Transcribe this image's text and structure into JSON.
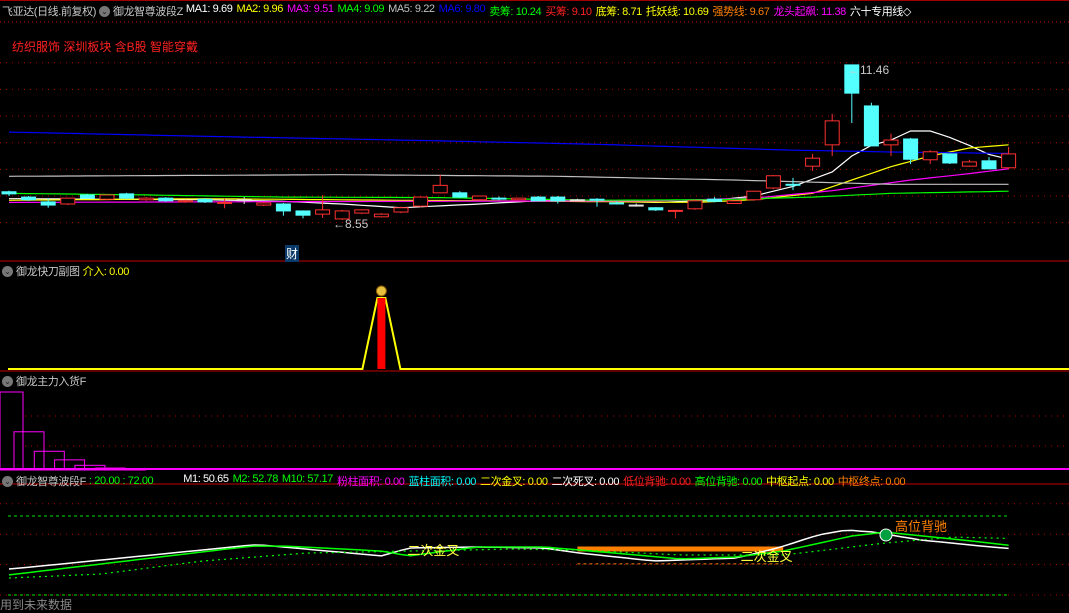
{
  "header": {
    "stock": "飞亚达(日线.前复权)",
    "indicator": "御龙智尊波段Z",
    "items": [
      {
        "label": "MA1: 9.69",
        "color": "#ffffff"
      },
      {
        "label": "MA2: 9.96",
        "color": "#ffff00"
      },
      {
        "label": "MA3: 9.51",
        "color": "#ff00ff"
      },
      {
        "label": "MA4: 9.09",
        "color": "#00ff00"
      },
      {
        "label": "MA5: 9.22",
        "color": "#c0c0c0"
      },
      {
        "label": "MA6: 9.80",
        "color": "#0000ff"
      },
      {
        "label": "卖筹: 10.24",
        "color": "#00ff00"
      },
      {
        "label": "买筹: 9.10",
        "color": "#ff2020"
      },
      {
        "label": "底筹: 8.71",
        "color": "#ffff00"
      },
      {
        "label": "托妖线: 10.69",
        "color": "#ffff00"
      },
      {
        "label": "强势线: 9.67",
        "color": "#ff8000"
      },
      {
        "label": "龙头起飙: 11.38",
        "color": "#ff00ff"
      },
      {
        "label": "六十专用线◇",
        "color": "#ffffff"
      }
    ]
  },
  "sectors": "纺织服饰 深圳板块 含B股 智能穿戴",
  "main_annotations": {
    "high": "←11.46",
    "low": "←8.55",
    "badge": "财"
  },
  "panel2": {
    "title": "御龙快刀副图",
    "value": "介入: 0.00"
  },
  "panel3": {
    "title": "御龙主力入货F"
  },
  "panel4": {
    "title": "御龙智尊波段F",
    "levels": ": 20.00  : 72.00",
    "items": [
      {
        "label": "M1: 50.65",
        "color": "#ffffff"
      },
      {
        "label": "M2: 52.78",
        "color": "#00ff00"
      },
      {
        "label": "M10: 57.17",
        "color": "#00ff00"
      },
      {
        "label": "粉柱面积: 0.00",
        "color": "#ff00ff"
      },
      {
        "label": "蓝柱面积: 0.00",
        "color": "#00ffff"
      },
      {
        "label": "二次金叉: 0.00",
        "color": "#ffff00"
      },
      {
        "label": "二次死叉: 0.00",
        "color": "#ffffff"
      },
      {
        "label": "低位背驰: 0.00",
        "color": "#ff2020"
      },
      {
        "label": "高位背驰: 0.00",
        "color": "#00ff00"
      },
      {
        "label": "中枢起点: 0.00",
        "color": "#ffff00"
      },
      {
        "label": "中枢终点: 0.00",
        "color": "#ff8000"
      }
    ],
    "signal_golden": "二次金叉",
    "signal_high": "高位背驰"
  },
  "footer": "用到未来数据",
  "chart_data": [
    {
      "type": "candlestick",
      "title": "飞亚达(日线.前复权)",
      "ylim": [
        8.5,
        11.5
      ],
      "candles": [
        [
          9.08,
          9.1,
          9.0,
          9.04
        ],
        [
          8.98,
          9.0,
          8.91,
          8.93
        ],
        [
          8.89,
          8.96,
          8.78,
          8.83
        ],
        [
          8.85,
          8.97,
          8.83,
          8.96
        ],
        [
          9.02,
          9.04,
          8.95,
          8.96
        ],
        [
          8.94,
          9.03,
          8.92,
          9.02
        ],
        [
          9.04,
          9.06,
          8.94,
          8.96
        ],
        [
          8.93,
          8.98,
          8.91,
          8.96
        ],
        [
          8.96,
          8.98,
          8.89,
          8.91
        ],
        [
          8.89,
          8.93,
          8.87,
          8.91
        ],
        [
          8.94,
          8.96,
          8.87,
          8.89
        ],
        [
          8.87,
          8.95,
          8.77,
          8.88
        ],
        [
          8.93,
          8.98,
          8.85,
          8.93
        ],
        [
          8.83,
          8.88,
          8.81,
          8.87
        ],
        [
          8.85,
          8.87,
          8.63,
          8.72
        ],
        [
          8.72,
          8.73,
          8.58,
          8.64
        ],
        [
          8.66,
          9.02,
          8.59,
          8.74
        ],
        [
          8.57,
          8.74,
          8.55,
          8.72
        ],
        [
          8.68,
          8.75,
          8.66,
          8.74
        ],
        [
          8.61,
          8.68,
          8.6,
          8.66
        ],
        [
          8.7,
          8.8,
          8.68,
          8.78
        ],
        [
          8.81,
          8.99,
          8.79,
          8.98
        ],
        [
          9.06,
          9.4,
          9.05,
          9.2
        ],
        [
          9.06,
          9.09,
          8.96,
          8.98
        ],
        [
          8.93,
          9.01,
          8.92,
          9.0
        ],
        [
          8.96,
          8.99,
          8.92,
          8.95
        ],
        [
          8.93,
          8.97,
          8.92,
          8.96
        ],
        [
          8.98,
          9.0,
          8.9,
          8.91
        ],
        [
          8.98,
          9.0,
          8.86,
          8.91
        ],
        [
          8.93,
          8.95,
          8.91,
          8.93
        ],
        [
          8.94,
          8.96,
          8.8,
          8.93
        ],
        [
          8.87,
          8.9,
          8.84,
          8.86
        ],
        [
          8.83,
          8.86,
          8.8,
          8.83
        ],
        [
          8.78,
          8.79,
          8.72,
          8.74
        ],
        [
          8.72,
          8.74,
          8.58,
          8.73
        ],
        [
          8.76,
          8.93,
          8.74,
          8.91
        ],
        [
          8.94,
          8.98,
          8.88,
          8.9
        ],
        [
          8.86,
          8.92,
          8.85,
          8.91
        ],
        [
          8.93,
          9.1,
          8.91,
          9.09
        ],
        [
          9.15,
          9.39,
          9.13,
          9.38
        ],
        [
          9.22,
          9.34,
          9.11,
          9.21
        ],
        [
          9.56,
          9.79,
          9.47,
          9.71
        ],
        [
          9.96,
          10.54,
          9.75,
          10.41
        ],
        [
          11.46,
          11.46,
          10.37,
          10.93
        ],
        [
          10.69,
          10.75,
          9.94,
          9.94
        ],
        [
          9.96,
          10.17,
          9.75,
          10.05
        ],
        [
          10.07,
          10.09,
          9.6,
          9.69
        ],
        [
          9.68,
          9.86,
          9.6,
          9.83
        ],
        [
          9.79,
          9.8,
          9.6,
          9.62
        ],
        [
          9.56,
          9.68,
          9.55,
          9.64
        ],
        [
          9.66,
          9.73,
          9.51,
          9.51
        ],
        [
          9.53,
          9.92,
          9.51,
          9.79
        ]
      ],
      "series": [
        {
          "name": "MA1",
          "color": "#ffffff",
          "points": [
            [
              0,
              8.95
            ],
            [
              10,
              8.93
            ],
            [
              14,
              8.9
            ],
            [
              17,
              8.85
            ],
            [
              20,
              8.78
            ],
            [
              24,
              8.85
            ],
            [
              28,
              8.93
            ],
            [
              33,
              8.88
            ],
            [
              36,
              8.92
            ],
            [
              38,
              9.0
            ],
            [
              40,
              9.18
            ],
            [
              42,
              9.45
            ],
            [
              43,
              9.75
            ],
            [
              44,
              9.95
            ],
            [
              45,
              10.05
            ],
            [
              46,
              10.22
            ],
            [
              47,
              10.22
            ],
            [
              48,
              10.1
            ],
            [
              49,
              9.95
            ],
            [
              50,
              9.78
            ],
            [
              51,
              9.69
            ]
          ]
        },
        {
          "name": "MA2",
          "color": "#ffff00",
          "points": [
            [
              0,
              8.92
            ],
            [
              10,
              8.95
            ],
            [
              20,
              8.92
            ],
            [
              28,
              8.9
            ],
            [
              35,
              8.88
            ],
            [
              38,
              8.93
            ],
            [
              41,
              9.05
            ],
            [
              43,
              9.3
            ],
            [
              45,
              9.55
            ],
            [
              47,
              9.75
            ],
            [
              49,
              9.9
            ],
            [
              51,
              9.96
            ]
          ]
        },
        {
          "name": "MA3",
          "color": "#ff00ff",
          "points": [
            [
              0,
              8.88
            ],
            [
              20,
              8.9
            ],
            [
              33,
              8.91
            ],
            [
              38,
              8.96
            ],
            [
              42,
              9.1
            ],
            [
              46,
              9.3
            ],
            [
              49,
              9.42
            ],
            [
              51,
              9.51
            ]
          ]
        },
        {
          "name": "MA4",
          "color": "#00ff00",
          "points": [
            [
              0,
              9.05
            ],
            [
              7,
              9.02
            ],
            [
              14,
              8.98
            ],
            [
              22,
              8.97
            ],
            [
              30,
              8.92
            ],
            [
              36,
              8.93
            ],
            [
              41,
              8.98
            ],
            [
              45,
              9.05
            ],
            [
              51,
              9.09
            ]
          ]
        },
        {
          "name": "MA5",
          "color": "#c0c0c0",
          "points": [
            [
              0,
              9.37
            ],
            [
              17,
              9.4
            ],
            [
              28,
              9.37
            ],
            [
              37,
              9.3
            ],
            [
              45,
              9.22
            ],
            [
              51,
              9.22
            ]
          ]
        },
        {
          "name": "MA6",
          "color": "#0000ff",
          "points": [
            [
              0,
              10.2
            ],
            [
              10,
              10.12
            ],
            [
              20,
              10.05
            ],
            [
              30,
              9.97
            ],
            [
              40,
              9.86
            ],
            [
              46,
              9.82
            ],
            [
              51,
              9.8
            ]
          ]
        }
      ]
    },
    {
      "type": "line",
      "title": "御龙快刀副图",
      "ylim": [
        0,
        1
      ],
      "spike_index": 19,
      "values_note": "介入 zero except one spike"
    },
    {
      "type": "bar",
      "title": "御龙主力入货F",
      "ylim": [
        0,
        100
      ],
      "values": [
        100,
        49,
        24,
        13,
        6,
        2.5,
        1
      ]
    },
    {
      "type": "line",
      "title": "御龙智尊波段F",
      "ylim": [
        20,
        80
      ],
      "levels": [
        20,
        72
      ],
      "series": [
        {
          "name": "M1",
          "color": "#ffffff",
          "points": [
            [
              0,
              37.1
            ],
            [
              1.6,
              39
            ],
            [
              12.4,
              52.9
            ],
            [
              12.9,
              52.9
            ],
            [
              19,
              45.7
            ],
            [
              20.4,
              50.9
            ],
            [
              23.9,
              51.6
            ],
            [
              27.3,
              50.9
            ],
            [
              29.1,
              47.6
            ],
            [
              32.9,
              42.4
            ],
            [
              34.3,
              43
            ],
            [
              37.1,
              44.3
            ],
            [
              39.2,
              50.9
            ],
            [
              41.3,
              59.5
            ],
            [
              42.7,
              62.8
            ],
            [
              44.1,
              61.4
            ],
            [
              46.5,
              56.2
            ],
            [
              49.6,
              52.2
            ],
            [
              51,
              50.65
            ]
          ]
        },
        {
          "name": "M2",
          "color": "#00ff00",
          "points": [
            [
              0,
              33.2
            ],
            [
              12.4,
              52.2
            ],
            [
              14.1,
              52.2
            ],
            [
              19,
              48.9
            ],
            [
              20.4,
              45.7
            ],
            [
              23.9,
              51.6
            ],
            [
              27.3,
              51.6
            ],
            [
              29.1,
              49.6
            ],
            [
              34.3,
              43.7
            ],
            [
              37.1,
              45
            ],
            [
              39.5,
              48.9
            ],
            [
              43,
              58.8
            ],
            [
              44.7,
              61.4
            ],
            [
              48.2,
              56.8
            ],
            [
              51,
              52.78
            ]
          ]
        },
        {
          "name": "M10",
          "color": "#00ff00",
          "dashed": true,
          "points": [
            [
              0,
              31.2
            ],
            [
              4.7,
              33.8
            ],
            [
              9.9,
              42.4
            ],
            [
              15.2,
              47.6
            ],
            [
              20.4,
              48.9
            ],
            [
              25.6,
              50.2
            ],
            [
              29.1,
              49.6
            ],
            [
              34.3,
              46.3
            ],
            [
              39.5,
              46.3
            ],
            [
              44.7,
              54.2
            ],
            [
              48.2,
              58.1
            ],
            [
              51,
              57.17
            ]
          ]
        }
      ],
      "zone": {
        "from_index": 29,
        "to_index": 39.5,
        "upper": 50.9,
        "lower": 40.5
      },
      "annotations": [
        {
          "text_ref": "signal_golden",
          "index": 21.5
        },
        {
          "text_ref": "signal_golden",
          "index": 38.5
        },
        {
          "text_ref": "signal_high",
          "index": 45
        }
      ]
    }
  ]
}
